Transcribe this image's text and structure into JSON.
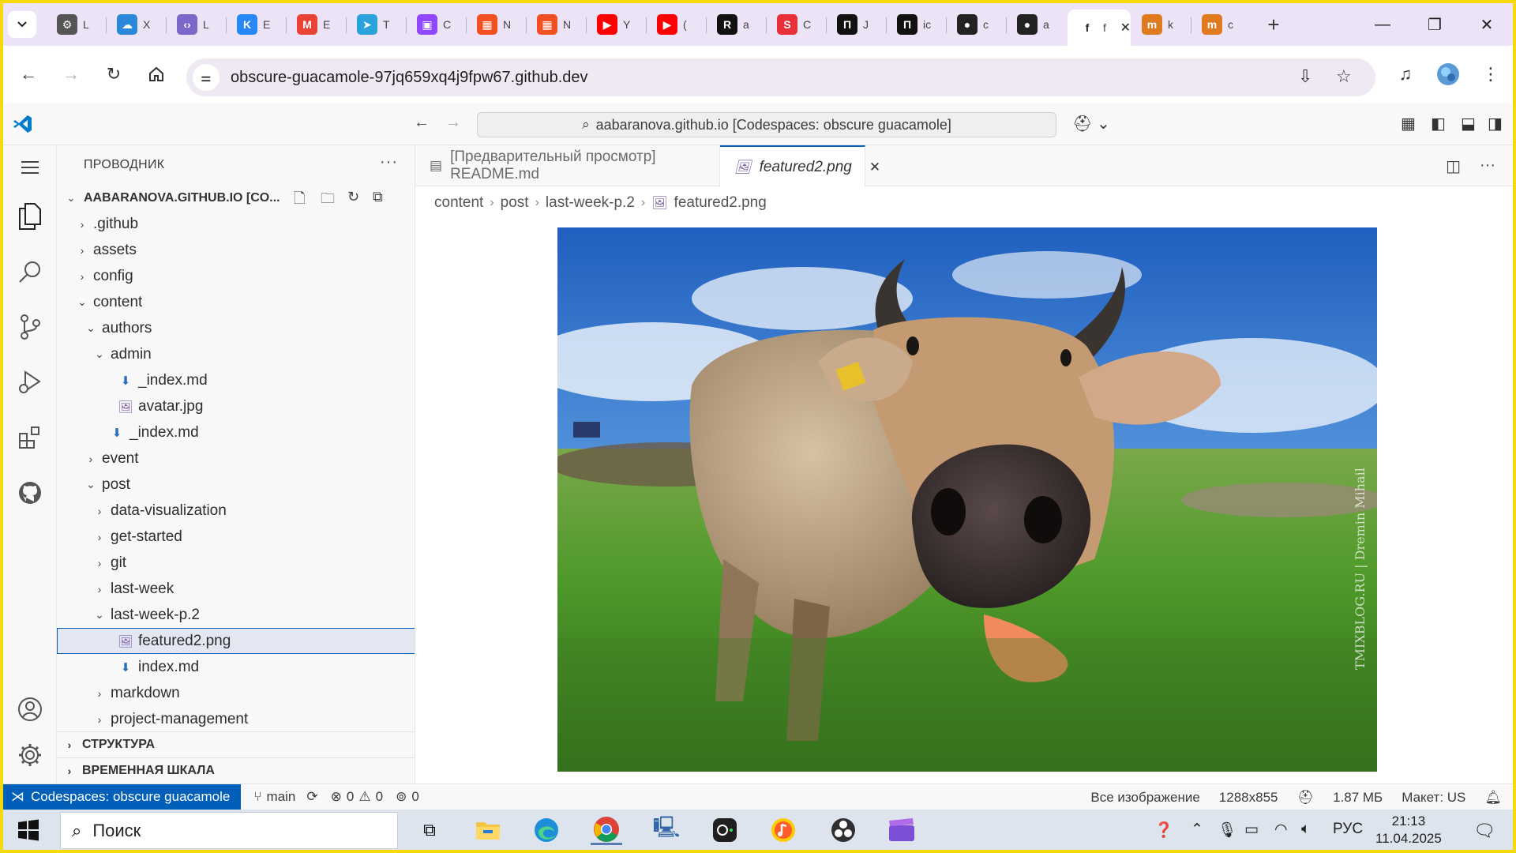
{
  "browser": {
    "tabs": [
      {
        "letter": "L",
        "color": "#555555",
        "glyph": "⚙"
      },
      {
        "letter": "X",
        "color": "#2b88d8",
        "glyph": "☁"
      },
      {
        "letter": "L",
        "color": "#7b68c8",
        "glyph": "‹›"
      },
      {
        "letter": "E",
        "color": "#2787f5",
        "glyph": "K"
      },
      {
        "letter": "E",
        "color": "#ea4335",
        "glyph": "M"
      },
      {
        "letter": "T",
        "color": "#2aa3dc",
        "glyph": "➤"
      },
      {
        "letter": "C",
        "color": "#9146ff",
        "glyph": "▣"
      },
      {
        "letter": "N",
        "color": "#f25022",
        "glyph": "▦"
      },
      {
        "letter": "N",
        "color": "#f25022",
        "glyph": "▦"
      },
      {
        "letter": "Y",
        "color": "#ff0000",
        "glyph": "▶"
      },
      {
        "letter": "(",
        "color": "#ff0000",
        "glyph": "▶"
      },
      {
        "letter": "a",
        "color": "#111111",
        "glyph": "R"
      },
      {
        "letter": "C",
        "color": "#e8303a",
        "glyph": "S"
      },
      {
        "letter": "J",
        "color": "#111111",
        "glyph": "П"
      },
      {
        "letter": "ic",
        "color": "#111111",
        "glyph": "П"
      },
      {
        "letter": "c",
        "color": "#222222",
        "glyph": "●"
      },
      {
        "letter": "a",
        "color": "#222222",
        "glyph": "●"
      },
      {
        "letter": "f",
        "color": "#ffffff",
        "glyph": "f",
        "active": true
      },
      {
        "letter": "k",
        "color": "#e07a1f",
        "glyph": "m"
      },
      {
        "letter": "c",
        "color": "#e07a1f",
        "glyph": "m"
      }
    ],
    "active_tab_close": "✕",
    "new_tab": "+",
    "url": "obscure-guacamole-97jq659xq4j9fpw67.github.dev"
  },
  "vscode": {
    "command_center": "aabaranova.github.io [Codespaces: obscure guacamole]",
    "explorer_title": "ПРОВОДНИК",
    "root_folder": "AABARANOVA.GITHUB.IO [CO...",
    "tree": [
      {
        "label": ".github",
        "depth": 0,
        "type": "folder",
        "open": false
      },
      {
        "label": "assets",
        "depth": 0,
        "type": "folder",
        "open": false
      },
      {
        "label": "config",
        "depth": 0,
        "type": "folder",
        "open": false
      },
      {
        "label": "content",
        "depth": 0,
        "type": "folder",
        "open": true
      },
      {
        "label": "authors",
        "depth": 1,
        "type": "folder",
        "open": true
      },
      {
        "label": "admin",
        "depth": 2,
        "type": "folder",
        "open": true
      },
      {
        "label": "_index.md",
        "depth": 3,
        "type": "md"
      },
      {
        "label": "avatar.jpg",
        "depth": 3,
        "type": "img"
      },
      {
        "label": "_index.md",
        "depth": 2,
        "type": "md"
      },
      {
        "label": "event",
        "depth": 1,
        "type": "folder",
        "open": false
      },
      {
        "label": "post",
        "depth": 1,
        "type": "folder",
        "open": true
      },
      {
        "label": "data-visualization",
        "depth": 2,
        "type": "folder",
        "open": false
      },
      {
        "label": "get-started",
        "depth": 2,
        "type": "folder",
        "open": false
      },
      {
        "label": "git",
        "depth": 2,
        "type": "folder",
        "open": false
      },
      {
        "label": "last-week",
        "depth": 2,
        "type": "folder",
        "open": false
      },
      {
        "label": "last-week-p.2",
        "depth": 2,
        "type": "folder",
        "open": true
      },
      {
        "label": "featured2.png",
        "depth": 3,
        "type": "img",
        "selected": true
      },
      {
        "label": "index.md",
        "depth": 3,
        "type": "md"
      },
      {
        "label": "markdown",
        "depth": 2,
        "type": "folder",
        "open": false
      },
      {
        "label": "project-management",
        "depth": 2,
        "type": "folder",
        "open": false
      }
    ],
    "sections": [
      "СТРУКТУРА",
      "ВРЕМЕННАЯ ШКАЛА"
    ],
    "editor_tabs": [
      {
        "label": "[Предварительный просмотр] README.md",
        "active": false
      },
      {
        "label": "featured2.png",
        "active": true
      }
    ],
    "breadcrumb": [
      "content",
      "post",
      "last-week-p.2",
      "featured2.png"
    ],
    "preview_watermark": "TMIXBLOG.RU | Dremin Mihail",
    "status": {
      "remote": "Codespaces: obscure guacamole",
      "branch": "main",
      "errors": "0",
      "warnings": "0",
      "ports": "0",
      "zoom_mode": "Все изображение",
      "dimensions": "1288x855",
      "size": "1.87 МБ",
      "layout": "Макет: US"
    }
  },
  "taskbar": {
    "search_placeholder": "Поиск",
    "lang": "РУС",
    "time": "21:13",
    "date": "11.04.2025"
  },
  "colors": {
    "accent": "#005fb8",
    "frame_border": "#f5d90a",
    "tab_strip": "#ece4f6"
  }
}
